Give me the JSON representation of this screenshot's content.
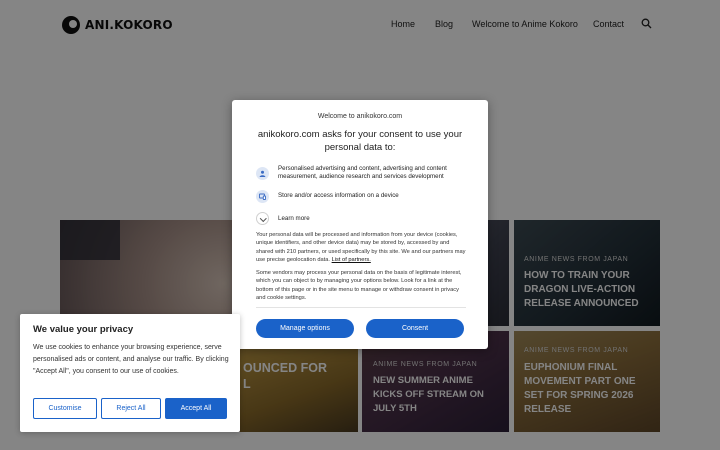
{
  "header": {
    "logo_text": "ANI.KOKORO",
    "nav": [
      "Home",
      "Blog",
      "Welcome to Anime Kokoro",
      "Contact"
    ],
    "search_icon": "search-icon"
  },
  "cards": [
    {
      "category": "",
      "title": ""
    },
    {
      "category": "",
      "title": "OUNCED FOR",
      "title2": "L"
    },
    {
      "category": "ANIME NEWS FROM JAPAN",
      "title": "NEW SUMMER ANIME KICKS OFF STREAM ON JULY 5TH"
    },
    {
      "category": "ANIME NEWS FROM JAPAN",
      "title": "HOW TO TRAIN YOUR DRAGON LIVE-ACTION RELEASE ANNOUNCED"
    },
    {
      "category": "ANIME NEWS FROM JAPAN",
      "title": "EUPHONIUM FINAL MOVEMENT PART ONE SET FOR SPRING 2026 RELEASE"
    }
  ],
  "consent": {
    "site": "Welcome to anikokoro.com",
    "title": "anikokoro.com asks for your consent to use your personal data to:",
    "purposes": [
      {
        "icon": "person-icon",
        "text": "Personalised advertising and content, advertising and content measurement, audience research and services development"
      },
      {
        "icon": "device-icon",
        "text": "Store and/or access information on a device"
      }
    ],
    "learn_more": "Learn more",
    "para1": "Your personal data will be processed and information from your device (cookies, unique identifiers, and other device data) may be stored by, accessed by and shared with 210 partners, or used specifically by this site. We and our partners may use precise geolocation data.",
    "partners_link": "List of partners.",
    "para2": "Some vendors may process your personal data on the basis of legitimate interest, which you can object to by managing your options below. Look for a link at the bottom of this page or in the site menu to manage or withdraw consent in privacy and cookie settings.",
    "manage_label": "Manage options",
    "consent_label": "Consent"
  },
  "privacy": {
    "title": "We value your privacy",
    "text": "We use cookies to enhance your browsing experience, serve personalised ads or content, and analyse our traffic. By clicking \"Accept All\", you consent to our use of cookies.",
    "customise": "Customise",
    "reject": "Reject All",
    "accept": "Accept All"
  },
  "colors": {
    "accent": "#1a62c9",
    "overlay": "rgba(0,0,0,0.48)"
  }
}
